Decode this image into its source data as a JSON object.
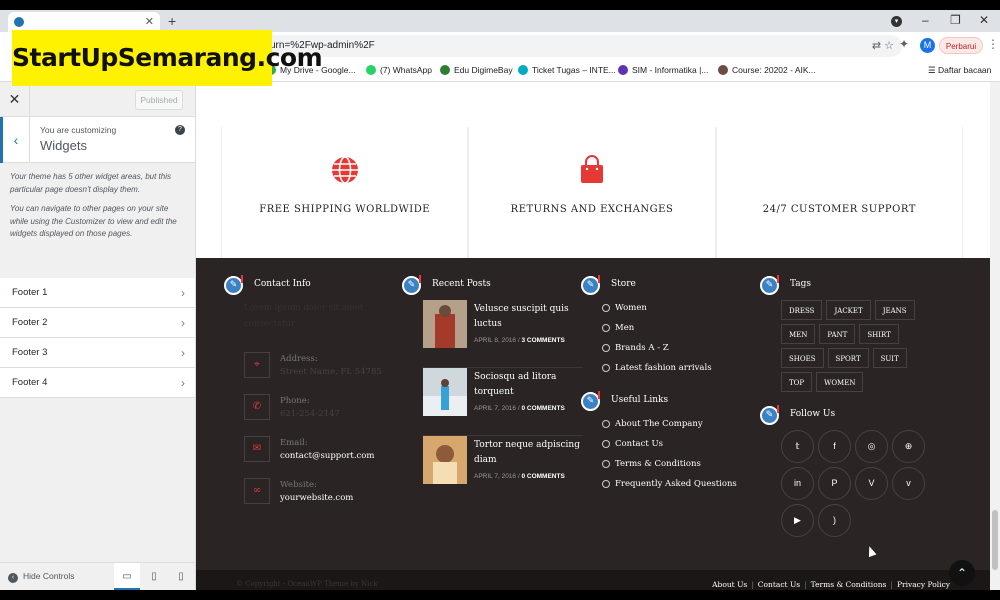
{
  "browser": {
    "url_fragment": "urn=%2Fwp-admin%2F",
    "update_label": "Perbarui",
    "avatar_letter": "M",
    "bookmarks": [
      {
        "label": "My Drive - Google...",
        "color": "#34a853"
      },
      {
        "label": "(7) WhatsApp",
        "color": "#25d366"
      },
      {
        "label": "Edu DigimeBay",
        "color": "#2e7d32"
      },
      {
        "label": "Ticket Tugas – INTE...",
        "color": "#00acc1"
      },
      {
        "label": "SIM - Informatika |...",
        "color": "#5e35b1"
      },
      {
        "label": "Course: 20202 - AIK...",
        "color": "#6d4c41"
      }
    ],
    "reading_list": "Daftar bacaan"
  },
  "overlay_logo": "StartUpSemarang.com",
  "customizer": {
    "published_label": "Published",
    "you_are_customizing": "You are customizing",
    "section_title": "Widgets",
    "notice_1": "Your theme has 5 other widget areas, but this particular page doesn't display them.",
    "notice_2": "You can navigate to other pages on your site while using the Customizer to view and edit the widgets displayed on those pages.",
    "sections": [
      "Footer 1",
      "Footer 2",
      "Footer 3",
      "Footer 4"
    ],
    "hide_controls": "Hide Controls"
  },
  "features": [
    {
      "label": "FREE SHIPPING WORLDWIDE",
      "icon": "globe-icon"
    },
    {
      "label": "RETURNS AND EXCHANGES",
      "icon": "shopping-bag-icon"
    },
    {
      "label": "24/7 CUSTOMER SUPPORT",
      "icon": "none"
    }
  ],
  "footer": {
    "contact": {
      "title": "Contact Info",
      "intro": "Lorem ipsum dolor sit amet consectetur",
      "address_label": "Address:",
      "address_value": "Street Name, FL 54785",
      "phone_label": "Phone:",
      "phone_value": "621-254-2147",
      "email_label": "Email:",
      "email_value": "contact@support.com",
      "website_label": "Website:",
      "website_value": "yourwebsite.com"
    },
    "recent_posts": {
      "title": "Recent Posts",
      "posts": [
        {
          "title": "Velusce suscipit quis luctus",
          "date": "APRIL 8, 2016",
          "comments": "3 COMMENTS"
        },
        {
          "title": "Sociosqu ad litora torquent",
          "date": "APRIL 7, 2016",
          "comments": "0 COMMENTS"
        },
        {
          "title": "Tortor neque adpiscing diam",
          "date": "APRIL 7, 2016",
          "comments": "0 COMMENTS"
        }
      ]
    },
    "store": {
      "title": "Store",
      "links": [
        "Women",
        "Men",
        "Brands A - Z",
        "Latest fashion arrivals"
      ]
    },
    "useful_links": {
      "title": "Useful Links",
      "links": [
        "About The Company",
        "Contact Us",
        "Terms & Conditions",
        "Frequently Asked Questions"
      ]
    },
    "tags": {
      "title": "Tags",
      "items": [
        "DRESS",
        "JACKET",
        "JEANS",
        "MEN",
        "PANT",
        "SHIRT",
        "SHOES",
        "SPORT",
        "SUIT",
        "TOP",
        "WOMEN"
      ]
    },
    "follow": {
      "title": "Follow Us",
      "icons": [
        "twitter-icon",
        "facebook-icon",
        "instagram-icon",
        "dribbble-icon",
        "linkedin-icon",
        "pinterest-icon",
        "vine-icon",
        "vimeo-icon",
        "youtube-icon",
        "rss-icon"
      ]
    },
    "copyright": "© Copyright - OceanWP Theme by Nick",
    "bottom_links": [
      "About Us",
      "Contact Us",
      "Terms & Conditions",
      "Privacy Policy"
    ]
  }
}
